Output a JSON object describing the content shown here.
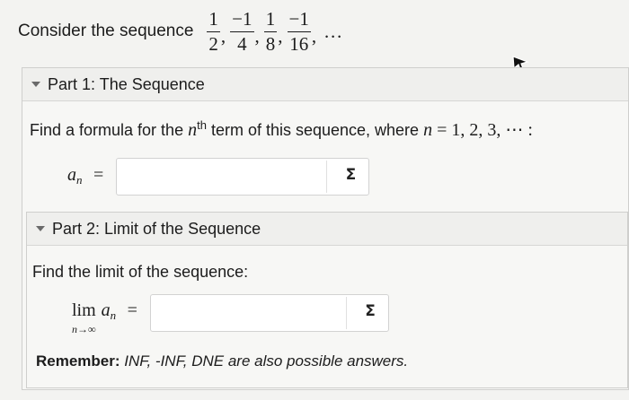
{
  "question": {
    "text": "Consider the sequence",
    "terms": [
      {
        "num": "1",
        "den": "2"
      },
      {
        "num": "−1",
        "den": "4"
      },
      {
        "num": "1",
        "den": "8"
      },
      {
        "num": "−1",
        "den": "16"
      }
    ],
    "separator": ",",
    "ellipsis": "…"
  },
  "part1": {
    "title": "Part 1: The Sequence",
    "instruction_pre": "Find a formula for the ",
    "instruction_var": "n",
    "instruction_sup": "th",
    "instruction_mid": " term of this sequence, where ",
    "instruction_cond_var": "n",
    "instruction_cond": " = 1, 2, 3, ⋯ :",
    "answer_label_var": "a",
    "answer_label_sub": "n",
    "answer_label_eq": "=",
    "answer_value": "",
    "sigma": "Σ"
  },
  "part2": {
    "title": "Part 2: Limit of the Sequence",
    "instruction": "Find the limit of the sequence:",
    "lim_word": "lim",
    "lim_sub": "n→∞",
    "lim_var": "a",
    "lim_var_sub": "n",
    "lim_eq": "=",
    "answer_value": "",
    "sigma": "Σ",
    "remember_bold": "Remember:",
    "remember_rest": " INF, -INF, DNE are also possible answers."
  }
}
